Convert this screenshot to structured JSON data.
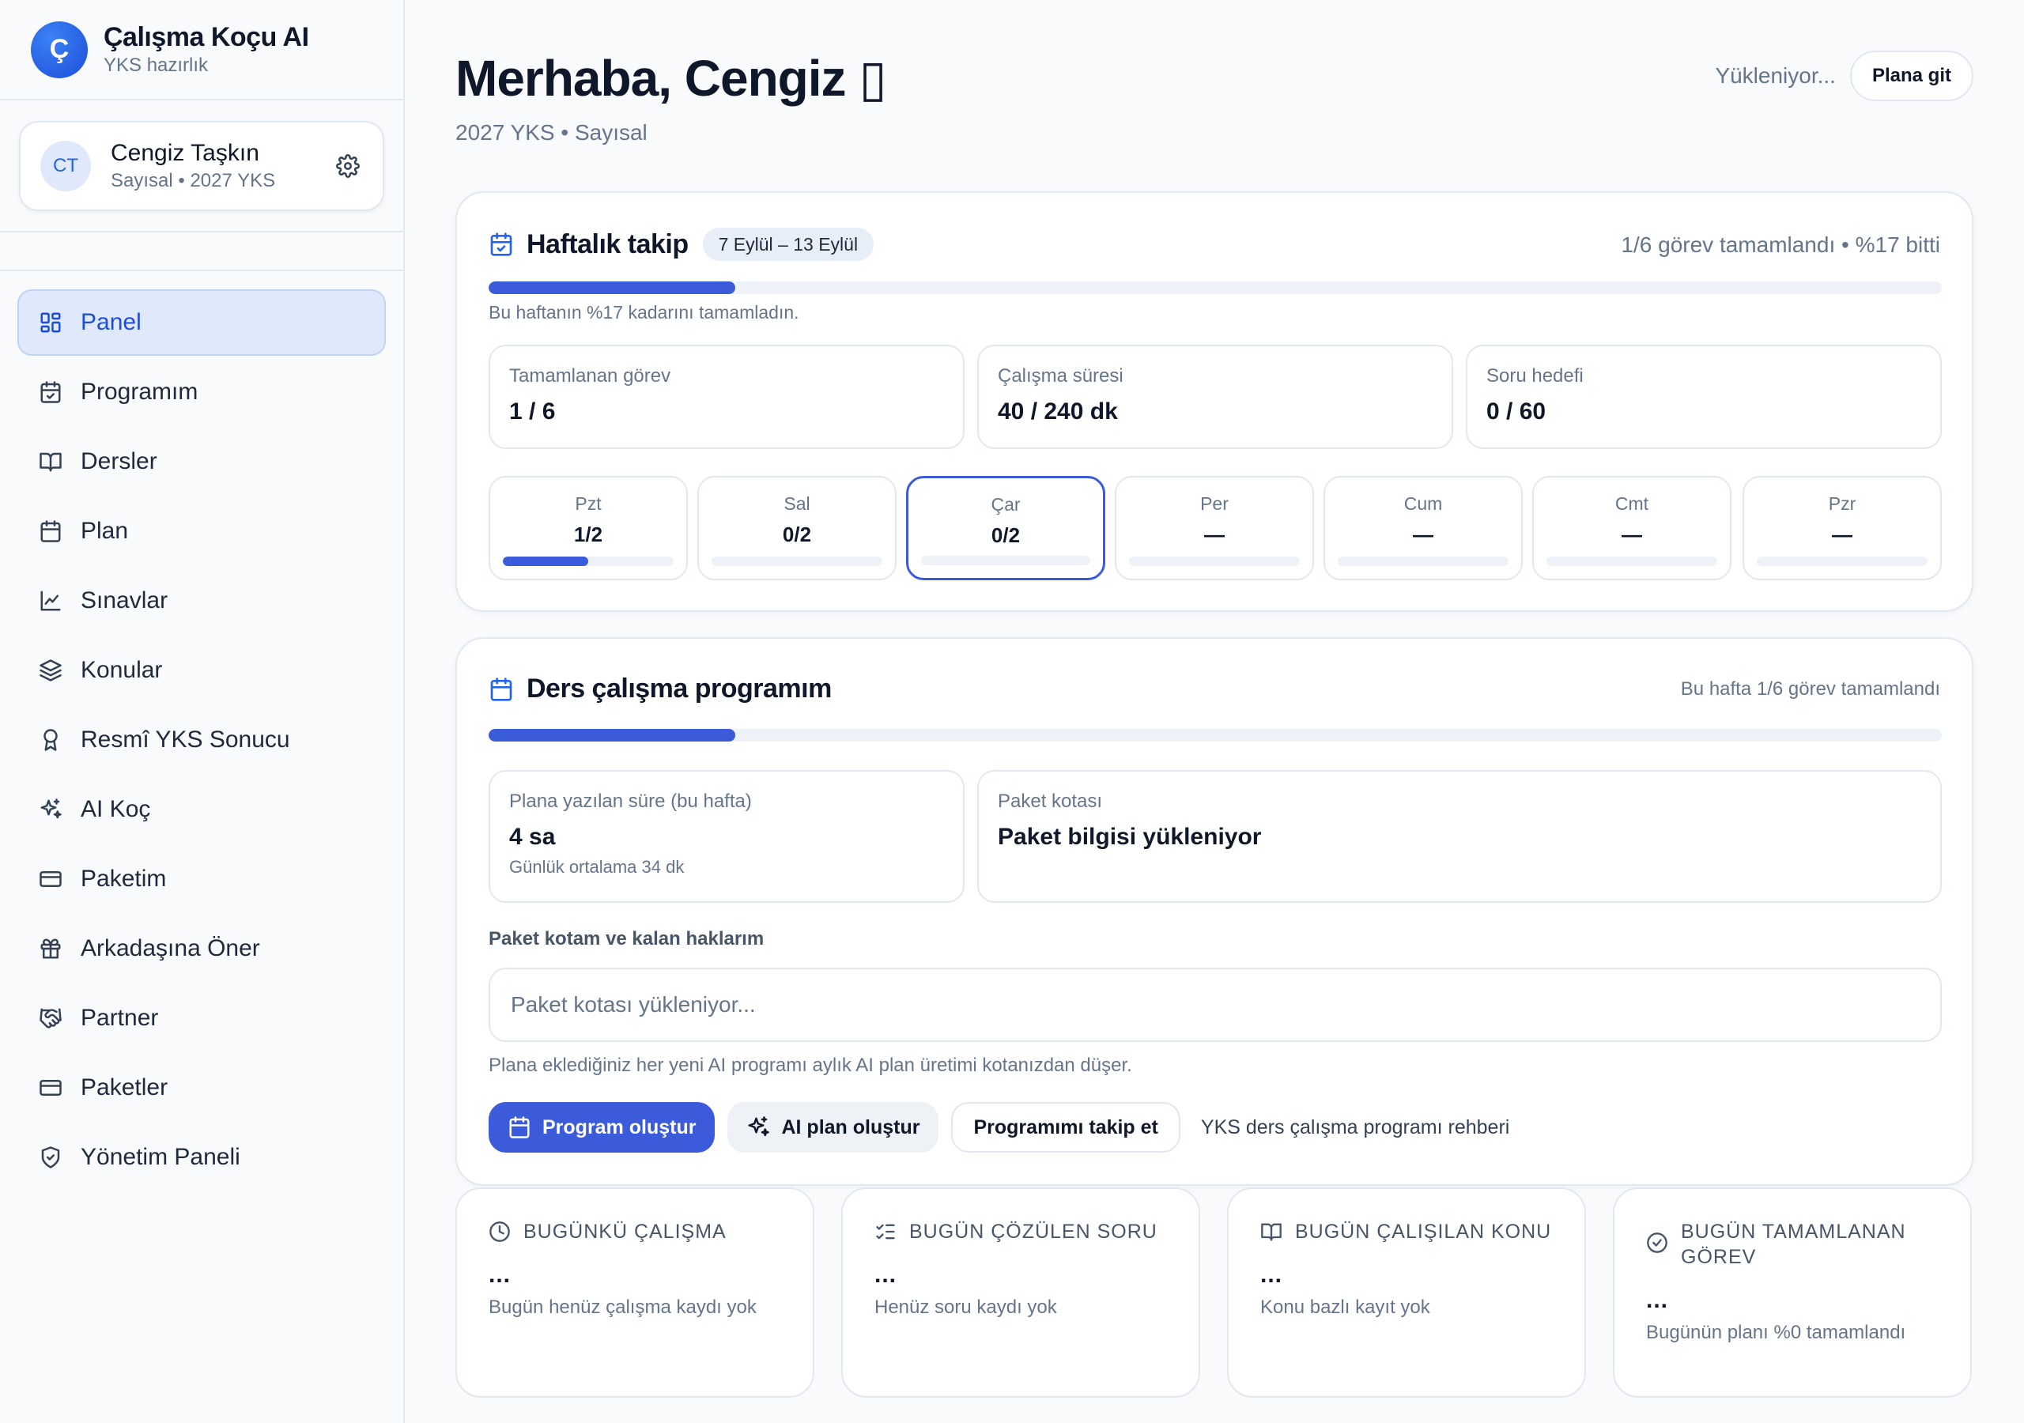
{
  "brand": {
    "logo_letter": "Ç",
    "title": "Çalışma Koçu AI",
    "subtitle": "YKS hazırlık"
  },
  "user": {
    "initials": "CT",
    "name": "Cengiz Taşkın",
    "meta": "Sayısal • 2027 YKS"
  },
  "nav": [
    {
      "label": "Panel",
      "icon": "dashboard-icon",
      "active": true
    },
    {
      "label": "Programım",
      "icon": "calendar-check-icon"
    },
    {
      "label": "Dersler",
      "icon": "book-open-icon"
    },
    {
      "label": "Plan",
      "icon": "calendar-icon"
    },
    {
      "label": "Sınavlar",
      "icon": "line-chart-icon"
    },
    {
      "label": "Konular",
      "icon": "layers-icon"
    },
    {
      "label": "Resmî YKS Sonucu",
      "icon": "award-icon"
    },
    {
      "label": "AI Koç",
      "icon": "sparkles-icon"
    },
    {
      "label": "Paketim",
      "icon": "credit-card-icon"
    },
    {
      "label": "Arkadaşına Öner",
      "icon": "gift-icon"
    },
    {
      "label": "Partner",
      "icon": "handshake-icon"
    },
    {
      "label": "Paketler",
      "icon": "credit-card-icon"
    },
    {
      "label": "Yönetim Paneli",
      "icon": "shield-icon"
    }
  ],
  "header": {
    "greeting": "Merhaba, Cengiz ▯",
    "subtitle": "2027 YKS • Sayısal",
    "status": "Yükleniyor...",
    "plan_button": "Plana git"
  },
  "weekly": {
    "title": "Haftalık takip",
    "range": "7 Eylül – 13 Eylül",
    "summary": "1/6 görev tamamlandı • %17 bitti",
    "progress": 0.17,
    "caption": "Bu haftanın %17 kadarını tamamladın.",
    "stats": [
      {
        "label": "Tamamlanan görev",
        "value": "1 / 6"
      },
      {
        "label": "Çalışma süresi",
        "value": "40 / 240 dk"
      },
      {
        "label": "Soru hedefi",
        "value": "0 / 60"
      }
    ],
    "days": [
      {
        "name": "Pzt",
        "value": "1/2",
        "progress": 0.5
      },
      {
        "name": "Sal",
        "value": "0/2",
        "progress": 0
      },
      {
        "name": "Çar",
        "value": "0/2",
        "progress": 0,
        "today": true
      },
      {
        "name": "Per",
        "value": "—",
        "progress": 0
      },
      {
        "name": "Cum",
        "value": "—",
        "progress": 0
      },
      {
        "name": "Cmt",
        "value": "—",
        "progress": 0
      },
      {
        "name": "Pzr",
        "value": "—",
        "progress": 0
      }
    ]
  },
  "program": {
    "title": "Ders çalışma programım",
    "summary": "Bu hafta 1/6 görev tamamlandı",
    "progress": 0.17,
    "planned": {
      "label": "Plana yazılan süre (bu hafta)",
      "value": "4 sa",
      "foot": "Günlük ortalama 34 dk"
    },
    "quota": {
      "label": "Paket kotası",
      "value": "Paket bilgisi yükleniyor"
    },
    "quota_field_label": "Paket kotam ve kalan haklarım",
    "quota_field_value": "Paket kotası yükleniyor...",
    "note": "Plana eklediğiniz her yeni AI programı aylık AI plan üretimi kotanızdan düşer.",
    "buttons": {
      "create": "Program oluştur",
      "ai_plan": "AI plan oluştur",
      "follow": "Programımı takip et",
      "guide": "YKS ders çalışma programı rehberi"
    }
  },
  "today": [
    {
      "title": "BUGÜNKÜ ÇALIŞMA",
      "icon": "clock-icon",
      "value": "...",
      "foot": "Bugün henüz çalışma kaydı yok"
    },
    {
      "title": "BUGÜN ÇÖZÜLEN SORU",
      "icon": "list-checks-icon",
      "value": "...",
      "foot": "Henüz soru kaydı yok"
    },
    {
      "title": "BUGÜN ÇALIŞILAN KONU",
      "icon": "book-open-icon",
      "value": "...",
      "foot": "Konu bazlı kayıt yok"
    },
    {
      "title": "BUGÜN TAMAMLANAN GÖREV",
      "icon": "check-circle-icon",
      "value": "...",
      "foot": "Bugünün planı %0 tamamlandı"
    }
  ],
  "colors": {
    "accent": "#3b5bdb",
    "active_nav_bg": "#dfe9fb",
    "border": "#e2e8f0",
    "muted": "#64748b"
  }
}
